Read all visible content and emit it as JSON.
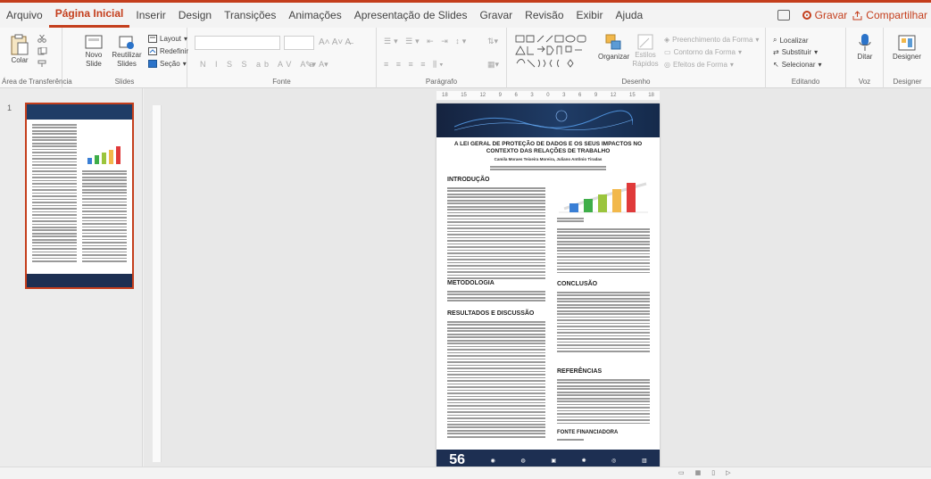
{
  "tabs": [
    "Arquivo",
    "Página Inicial",
    "Inserir",
    "Design",
    "Transições",
    "Animações",
    "Apresentação de Slides",
    "Gravar",
    "Revisão",
    "Exibir",
    "Ajuda"
  ],
  "actions": {
    "record": "Gravar",
    "share": "Compartilhar"
  },
  "ribbon": {
    "clipboard": {
      "paste": "Colar",
      "group": "Área de Transferência"
    },
    "slides": {
      "new_slide_1": "Novo",
      "new_slide_2": "Slide",
      "reuse_1": "Reutilizar",
      "reuse_2": "Slides",
      "layout": "Layout",
      "reset": "Redefinir",
      "section": "Seção",
      "group": "Slides"
    },
    "font": {
      "group": "Fonte"
    },
    "paragraph": {
      "group": "Parágrafo"
    },
    "drawing": {
      "arrange": "Organizar",
      "styles_1": "Estilos",
      "styles_2": "Rápidos",
      "fill": "Preenchimento da Forma",
      "outline": "Contorno da Forma",
      "effects": "Efeitos de Forma",
      "group": "Desenho"
    },
    "editing": {
      "find": "Localizar",
      "replace": "Substituir",
      "select": "Selecionar",
      "group": "Editando"
    },
    "voice": {
      "dictate": "Ditar",
      "group": "Voz"
    },
    "designer": {
      "label": "Designer",
      "group": "Designer"
    }
  },
  "slide_panel": {
    "number": "1"
  },
  "slide": {
    "title": "A LEI GERAL DE PROTEÇÃO DE DADOS E OS SEUS IMPACTOS NO CONTEXTO DAS RELAÇÕES DE TRABALHO",
    "authors": "Camila Moraes Teixeira Moreira, Juliano Antônio Tiradas",
    "headings": [
      "INTRODUÇÃO",
      "METODOLOGIA",
      "RESULTADOS E DISCUSSÃO",
      "CONCLUSÃO",
      "REFERÊNCIAS",
      "FONTE FINANCIADORA"
    ],
    "footer_number": "56"
  },
  "ruler": [
    "18",
    "15",
    "12",
    "9",
    "6",
    "3",
    "0",
    "3",
    "6",
    "9",
    "12",
    "15",
    "18"
  ]
}
